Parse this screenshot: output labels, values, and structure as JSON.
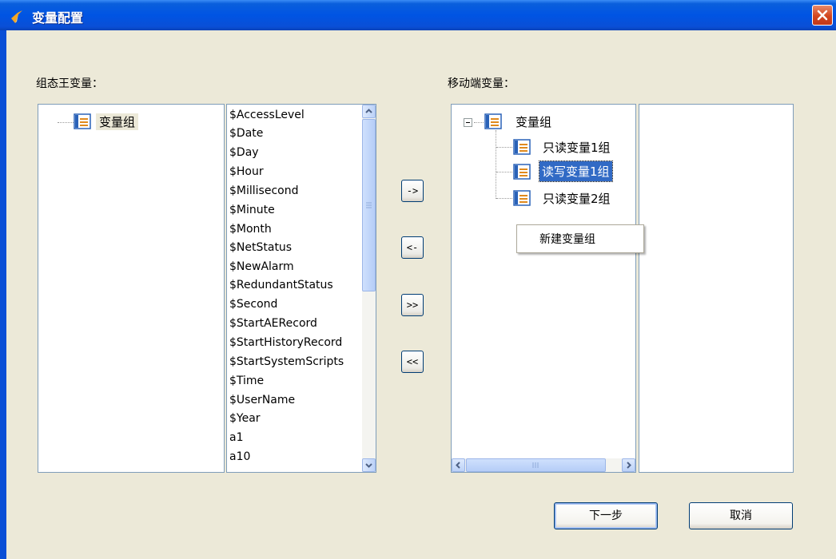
{
  "window": {
    "title": "变量配置"
  },
  "left_section": {
    "label": "组态王变量：",
    "tree_root": "变量组",
    "variables": [
      "$AccessLevel",
      "$Date",
      "$Day",
      "$Hour",
      "$Millisecond",
      "$Minute",
      "$Month",
      "$NetStatus",
      "$NewAlarm",
      "$RedundantStatus",
      "$Second",
      "$StartAERecord",
      "$StartHistoryRecord",
      "$StartSystemScripts",
      "$Time",
      "$UserName",
      "$Year",
      "a1",
      "a10"
    ]
  },
  "transfer_buttons": {
    "add": "->",
    "remove": "<-",
    "add_all": ">>",
    "remove_all": "<<"
  },
  "right_section": {
    "label": "移动端变量：",
    "tree_root": "变量组",
    "groups": [
      {
        "label": "只读变量1组",
        "selected": false
      },
      {
        "label": "读写变量1组",
        "selected": true
      },
      {
        "label": "只读变量2组",
        "selected": false
      }
    ]
  },
  "context_menu": {
    "items": [
      "新建变量组"
    ]
  },
  "footer": {
    "next_label": "下一步",
    "cancel_label": "取消"
  },
  "colors": {
    "title_bar": "#0054e3",
    "selection": "#316ac5",
    "dialog_bg": "#ece9d8"
  }
}
